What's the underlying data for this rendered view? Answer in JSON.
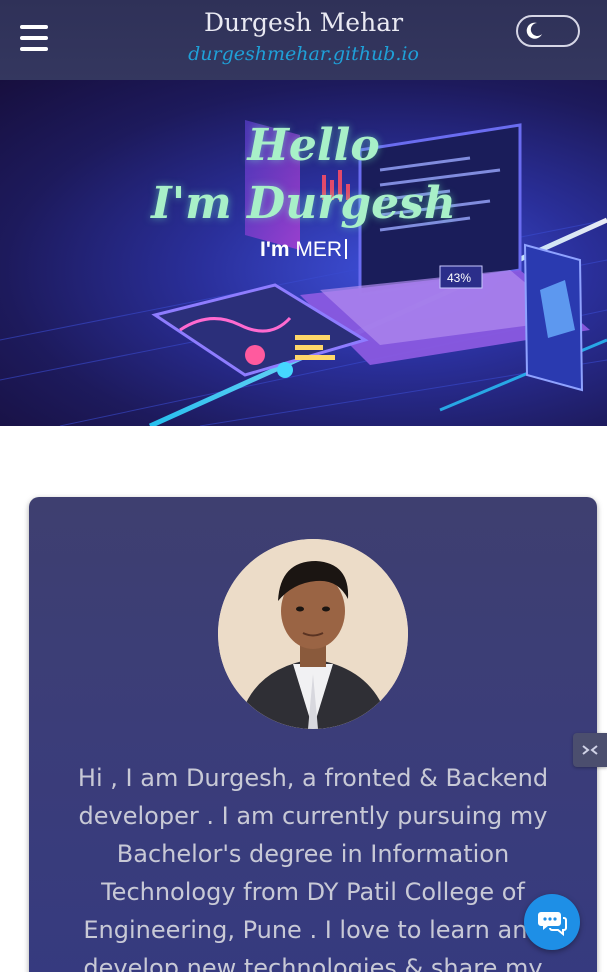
{
  "header": {
    "title": "Durgesh Mehar",
    "url": "durgeshmehar.github.io",
    "menu_icon": "hamburger-icon",
    "theme_icon": "moon-icon"
  },
  "hero": {
    "hello": "Hello",
    "name": "I'm Durgesh",
    "typed_prefix": "I'm",
    "typed_text": "MER",
    "percent_badge": "43%"
  },
  "about": {
    "text": "Hi , I am Durgesh, a fronted & Backend developer . I am currently pursuing my Bachelor's degree in Information Technology from DY Patil College of Engineering, Pune . I love to learn and develop new technologies & share my"
  },
  "widgets": {
    "side_icon": "expand-icon",
    "chat_icon": "chat-icon"
  },
  "colors": {
    "header_bg": "#2f3158",
    "url_color": "#1fa0d8",
    "hero_text": "#a8f0c8",
    "card_bg": "#3b3d79",
    "chat_button": "#1e8fe6"
  }
}
